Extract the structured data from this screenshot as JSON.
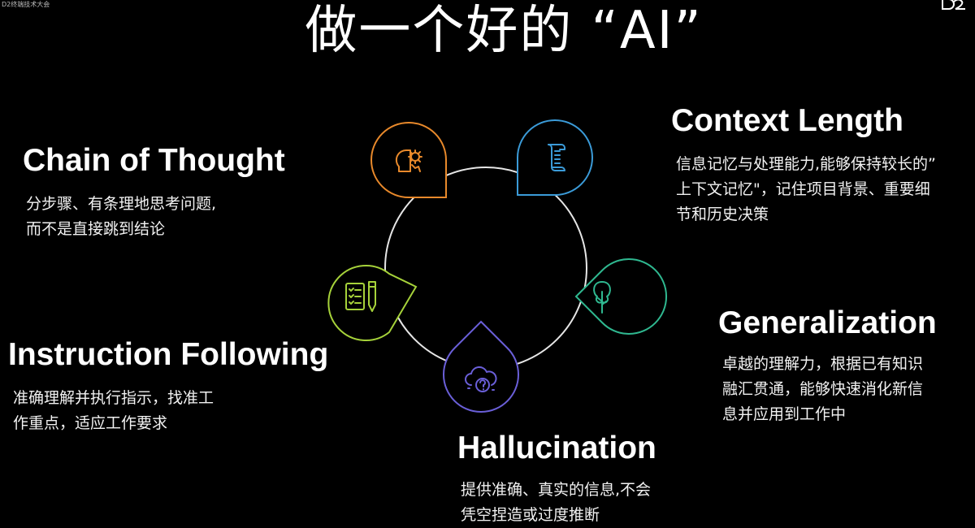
{
  "conference_tag": "D2终端技术大会",
  "title": "做一个好的 “AI”",
  "features": [
    {
      "heading": "Chain of Thought",
      "lines": [
        "分步骤、有条理地思考问题,",
        "而不是直接跳到结论"
      ],
      "color": "#e8892b",
      "icon": "head-gear-icon"
    },
    {
      "heading": "Context Length",
      "lines": [
        "信息记忆与处理能力,能够保持较长的”",
        "上下文记忆\"，记住项目背景、重要细",
        "节和历史决策"
      ],
      "color": "#3b9bd8",
      "icon": "scroll-document-icon"
    },
    {
      "heading": "Generalization",
      "lines": [
        "卓越的理解力，根据已有知识",
        "融汇贯通，能够快速消化新信",
        "息并应用到工作中"
      ],
      "color": "#2fb890",
      "icon": "tree-icon"
    },
    {
      "heading": "Hallucination",
      "lines": [
        "提供准确、真实的信息,不会",
        "凭空捏造或过度推断"
      ],
      "color": "#6a5fd8",
      "icon": "cloud-question-icon"
    },
    {
      "heading": "Instruction Following",
      "lines": [
        "准确理解并执行指示，找准工",
        "作重点，适应工作要求"
      ],
      "color": "#a6d23a",
      "icon": "checklist-pen-icon"
    }
  ]
}
